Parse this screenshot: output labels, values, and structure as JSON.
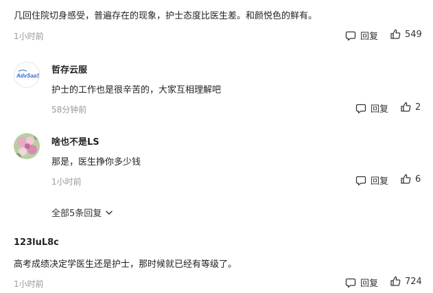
{
  "comments": [
    {
      "text": "几回住院切身感受，普遍存在的现象，护士态度比医生差。和颜悦色的鲜有。",
      "time": "1小时前",
      "reply_label": "回复",
      "likes": "549"
    },
    {
      "author": "123luL8c",
      "text": "高考成绩决定学医生还是护士，那时候就已经有等级了。",
      "time": "1小时前",
      "reply_label": "回复",
      "likes": "724"
    }
  ],
  "replies": [
    {
      "author": "哲存云服",
      "avatar_text": "AdvSaaS",
      "text": "护士的工作也是很辛苦的，大家互相理解吧",
      "time": "58分钟前",
      "reply_label": "回复",
      "likes": "2"
    },
    {
      "author": "啥也不是LS",
      "text": "那是，医生挣你多少钱",
      "time": "1小时前",
      "reply_label": "回复",
      "likes": "6"
    }
  ],
  "expand_label": "全部5条回复",
  "icons": {
    "reply": "speech-bubble-icon",
    "like": "thumbs-up-icon",
    "expand": "chevron-down-icon"
  },
  "colors": {
    "text": "#222222",
    "meta": "#999999",
    "avatar_blue": "#2a6fd6"
  }
}
